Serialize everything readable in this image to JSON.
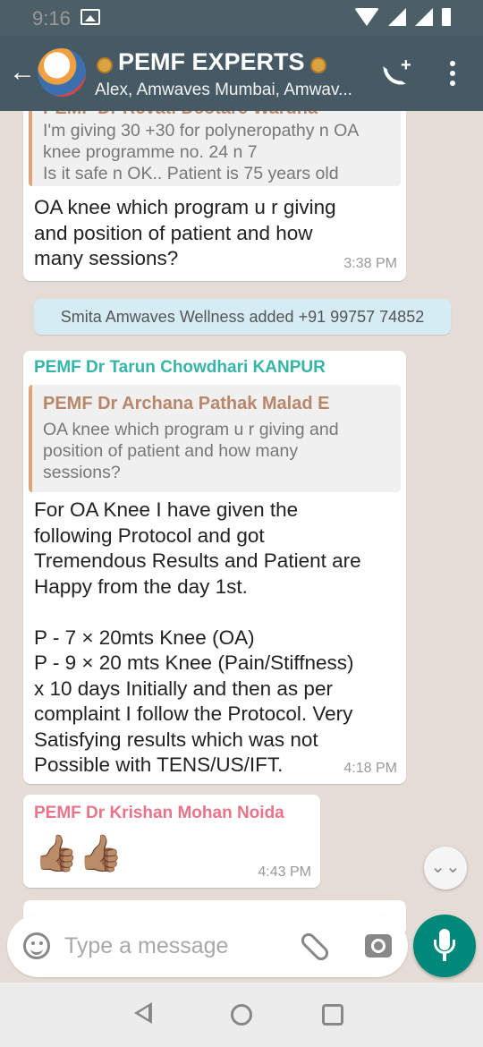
{
  "status_bar": {
    "time": "9:16"
  },
  "header": {
    "back_icon": "arrow-left-icon",
    "title": "PEMF EXPERTS",
    "subtitle": "Alex, Amwaves Mumbai, Amwav...",
    "add_call_icon": "add-call-icon",
    "menu_icon": "more-vert-icon"
  },
  "messages": [
    {
      "quoted_sender": "PEMF Dr Revati Deotare Wardha",
      "quoted_text": "I'm giving 30 +30 for polyneropathy n OA\nknee programme no. 24 n 7\nIs it safe n OK.. Patient is 75 years old",
      "text": "OA knee which program  u r giving\nand position  of patient and how\nmany sessions?",
      "time": "3:38 PM"
    },
    {
      "system": "Smita Amwaves Wellness added +91 99757 74852"
    },
    {
      "sender": "PEMF Dr Tarun Chowdhari KANPUR",
      "sender_color": "#35b5a6",
      "quoted_sender": "PEMF Dr Archana Pathak Malad E",
      "quoted_text": "OA knee which program  u r giving and\nposition  of patient and how  many\nsessions?",
      "text": "For OA Knee I have given the\nfollowing Protocol and got\nTremendous Results and Patient are\nHappy from the day 1st.\n\nP - 7  ×  20mts  Knee (OA)\nP - 9  ×  20 mts Knee (Pain/Stiffness)\nx 10 days Initially and then as per\ncomplaint I follow the Protocol. Very\nSatisfying results which was not\nPossible with TENS/US/IFT.",
      "time": "4:18 PM"
    },
    {
      "sender": "PEMF Dr Krishan Mohan Noida",
      "sender_color": "#e8748a",
      "text": "👍🏽👍🏽",
      "time": "4:43 PM"
    }
  ],
  "composer": {
    "placeholder": "Type a message",
    "emoji_icon": "emoji-icon",
    "attach_icon": "paperclip-icon",
    "camera_icon": "camera-icon",
    "mic_icon": "microphone-icon"
  }
}
